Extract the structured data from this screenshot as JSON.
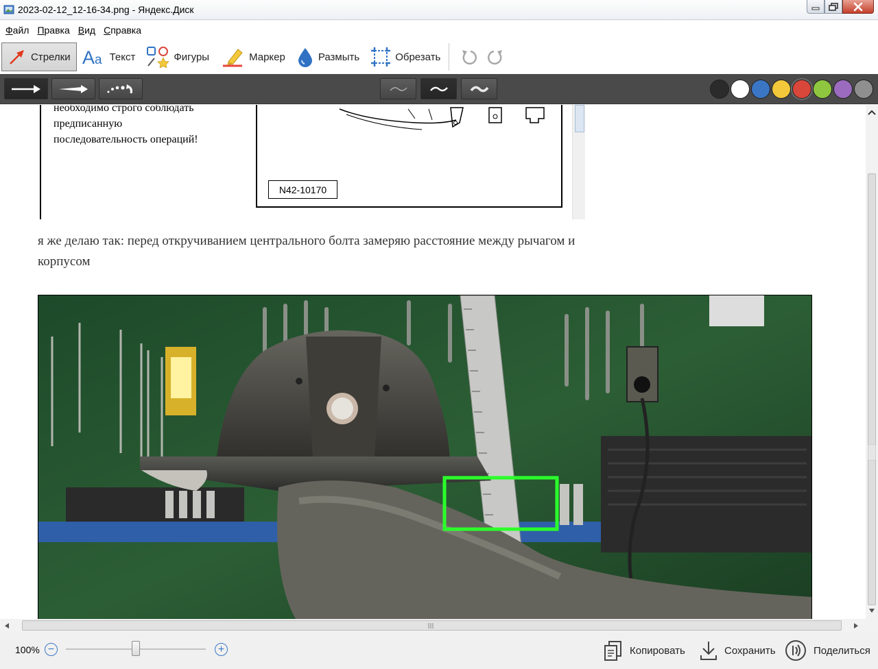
{
  "window": {
    "title": "2023-02-12_12-16-34.png - Яндекс.Диск"
  },
  "menu": {
    "items": [
      {
        "label": "Файл",
        "key": "Ф",
        "rest": "айл"
      },
      {
        "label": "Правка",
        "key": "П",
        "rest": "равка"
      },
      {
        "label": "Вид",
        "key": "В",
        "rest": "ид"
      },
      {
        "label": "Справка",
        "key": "С",
        "rest": "правка"
      }
    ]
  },
  "toolbar": {
    "arrows": "Стрелки",
    "text": "Текст",
    "shapes": "Фигуры",
    "marker": "Маркер",
    "blur": "Размыть",
    "crop": "Обрезать"
  },
  "palette": {
    "colors": [
      "#2b2b2b",
      "#ffffff",
      "#3a76c4",
      "#f3c83a",
      "#d9473b",
      "#8ec63f",
      "#9b6bbf",
      "#8f8f8f"
    ],
    "selected": "#d9473b"
  },
  "document": {
    "note_lines": [
      "необходимо строго соблюдать",
      "предписанную",
      "последовательность операций!"
    ],
    "figure_code": "N42-10170",
    "post_text": "я же делаю так: перед откручиванием центрального болта замеряю расстояние между рычагом и корпусом"
  },
  "status": {
    "zoom": "100%",
    "zoom_level": 0.5,
    "copy": "Копировать",
    "save": "Сохранить",
    "share": "Поделиться"
  }
}
